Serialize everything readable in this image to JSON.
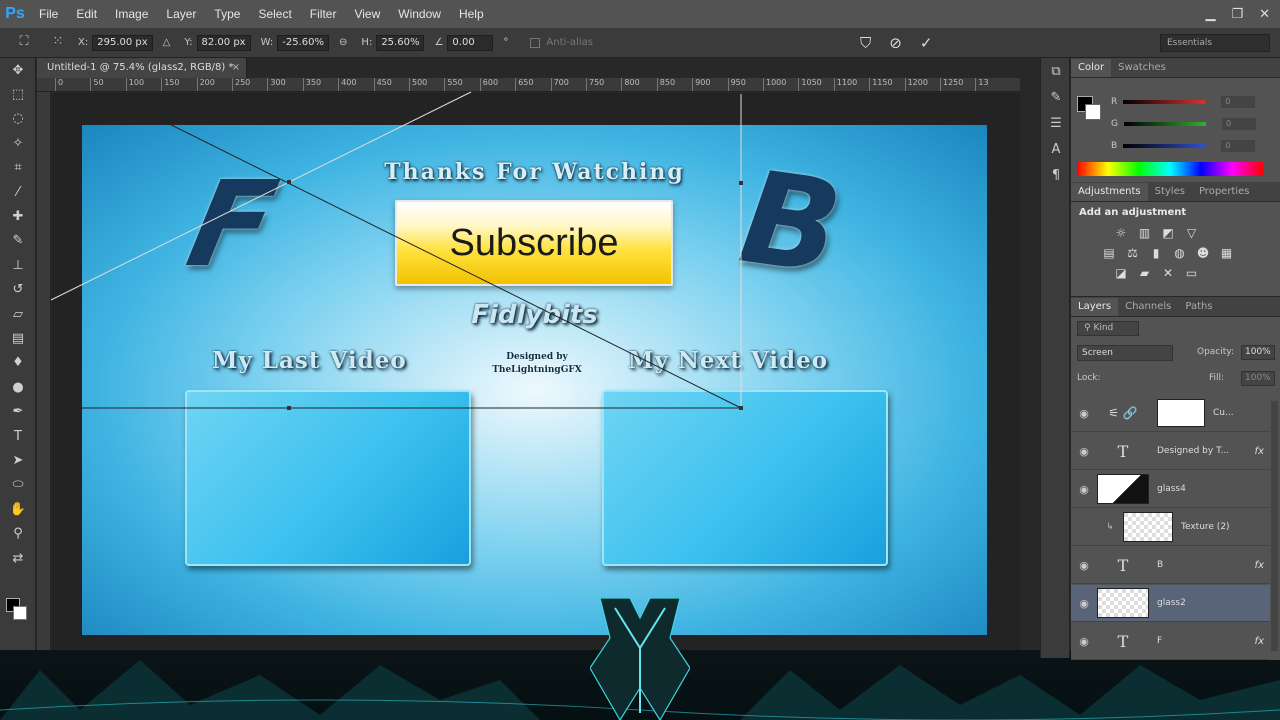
{
  "app": {
    "logo": "Ps"
  },
  "menu": [
    "File",
    "Edit",
    "Image",
    "Layer",
    "Type",
    "Select",
    "Filter",
    "View",
    "Window",
    "Help"
  ],
  "window_controls": {
    "minimize": "▁",
    "maximize": "❐",
    "close": "✕"
  },
  "options_bar": {
    "x_label": "X:",
    "x_value": "295.00 px",
    "y_label": "Y:",
    "y_value": "82.00 px",
    "w_label": "W:",
    "w_value": "-25.60%",
    "h_label": "H:",
    "h_value": "25.60%",
    "angle_value": "0.00",
    "degree": "°",
    "antialias_label": "Anti-alias",
    "workspace": "Essentials"
  },
  "document": {
    "tab_title": "Untitled-1 @ 75.4% (glass2, RGB/8) *",
    "tab_close": "×",
    "ruler_ticks": [
      "0",
      "50",
      "100",
      "150",
      "200",
      "250",
      "300",
      "350",
      "400",
      "450",
      "500",
      "550",
      "600",
      "650",
      "700",
      "750",
      "800",
      "850",
      "900",
      "950",
      "1000",
      "1050",
      "1100",
      "1150",
      "1200",
      "1250",
      "13"
    ]
  },
  "artwork": {
    "title": "Thanks For Watching",
    "subscribe": "Subscribe",
    "brand": "Fidlybits",
    "last_video": "My Last Video",
    "next_video": "My Next Video",
    "designed_line1": "Designed by",
    "designed_line2": "TheLightningGFX",
    "letter_left": "F",
    "letter_right": "B"
  },
  "color_panel": {
    "tabs": [
      "Color",
      "Swatches"
    ],
    "r_label": "R",
    "g_label": "G",
    "b_label": "B",
    "r_value": "0",
    "g_value": "0",
    "b_value": "0",
    "r_color": "#e03030",
    "g_color": "#30b030",
    "b_color": "#3050d0"
  },
  "adjustments_panel": {
    "tabs": [
      "Adjustments",
      "Styles",
      "Properties"
    ],
    "heading": "Add an adjustment",
    "row1": [
      "☼",
      "▥",
      "◩",
      "▽"
    ],
    "row2": [
      "▤",
      "⚖",
      "▮",
      "◍",
      "☻",
      "▦"
    ],
    "row3": [
      "◪",
      "▰",
      "✕",
      "▭"
    ]
  },
  "layers_panel": {
    "tabs": [
      "Layers",
      "Channels",
      "Paths"
    ],
    "kind_label": "Kind",
    "blend_mode": "Screen",
    "opacity_label": "Opacity:",
    "opacity_value": "100%",
    "lock_label": "Lock:",
    "fill_label": "Fill:",
    "fill_value": "100%",
    "layers": [
      {
        "name": "Cu...",
        "type": "adjustment"
      },
      {
        "name": "Designed by T...",
        "type": "text",
        "fx": "fx"
      },
      {
        "name": "glass4",
        "type": "image"
      },
      {
        "name": "Texture (2)",
        "type": "image"
      },
      {
        "name": "B",
        "type": "text",
        "fx": "fx"
      },
      {
        "name": "glass2",
        "type": "image",
        "selected": true
      },
      {
        "name": "F",
        "type": "text",
        "fx": "fx"
      }
    ],
    "eye_glyph": "◉"
  },
  "accent": "#31a8ff"
}
